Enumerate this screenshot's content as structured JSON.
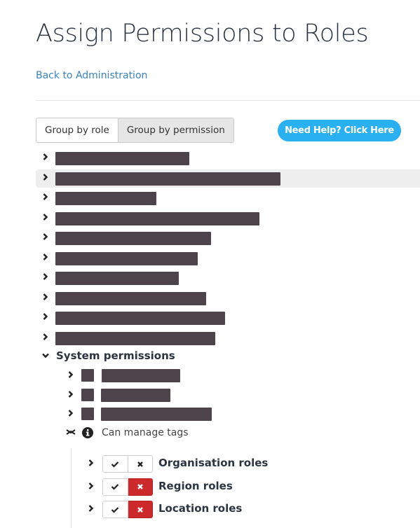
{
  "page": {
    "title": "Assign Permissions to Roles",
    "back_link": "Back to Administration"
  },
  "toolbar": {
    "group_by_role": "Group by role",
    "group_by_permission": "Group by permission",
    "active_grouping": "Group by permission",
    "help_button": "Need Help? Click Here"
  },
  "colors": {
    "link": "#3a83c2",
    "help_button": "#29b0f0",
    "denied": "#cc2a2a",
    "redaction": "#4d444b"
  },
  "permission_groups": [
    {
      "label": "[redacted]",
      "expanded": false
    },
    {
      "label": "[redacted]",
      "expanded": false,
      "hovered": true
    },
    {
      "label": "[redacted]",
      "expanded": false
    },
    {
      "label": "[redacted]",
      "expanded": false
    },
    {
      "label": "[redacted]",
      "expanded": false
    },
    {
      "label": "[redacted]",
      "expanded": false
    },
    {
      "label": "[redacted]",
      "expanded": false
    },
    {
      "label": "[redacted]",
      "expanded": false
    },
    {
      "label": "[redacted]",
      "expanded": false
    },
    {
      "label": "[redacted]",
      "expanded": false
    }
  ],
  "system_permissions": {
    "label": "System permissions",
    "expanded": true,
    "items": [
      {
        "label": "[redacted]",
        "expanded": false
      },
      {
        "label": "[redacted]",
        "expanded": false
      },
      {
        "label": "[redacted]",
        "expanded": false
      }
    ],
    "open_item": {
      "label": "Can manage tags",
      "icon": "info-icon",
      "role_groups": [
        {
          "label": "Organisation roles",
          "allow_state": "neutral",
          "deny_state": "neutral"
        },
        {
          "label": "Region roles",
          "allow_state": "neutral",
          "deny_state": "denied"
        },
        {
          "label": "Location roles",
          "allow_state": "neutral",
          "deny_state": "denied"
        }
      ]
    }
  }
}
